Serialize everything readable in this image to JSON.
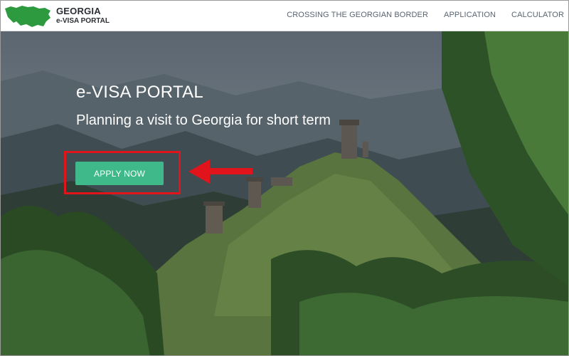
{
  "header": {
    "brand_title": "GEORGIA",
    "brand_subtitle": "e-VISA PORTAL",
    "nav": [
      {
        "label": "CROSSING THE GEORGIAN BORDER"
      },
      {
        "label": "APPLICATION"
      },
      {
        "label": "CALCULATOR"
      }
    ]
  },
  "hero": {
    "title": "e-VISA PORTAL",
    "subtitle": "Planning a visit to Georgia for short term",
    "apply_label": "APPLY NOW"
  },
  "colors": {
    "brand_green": "#2e9a3f",
    "button": "#3fb98a",
    "annotation_red": "#e0141a",
    "nav_text": "#5a6470"
  }
}
